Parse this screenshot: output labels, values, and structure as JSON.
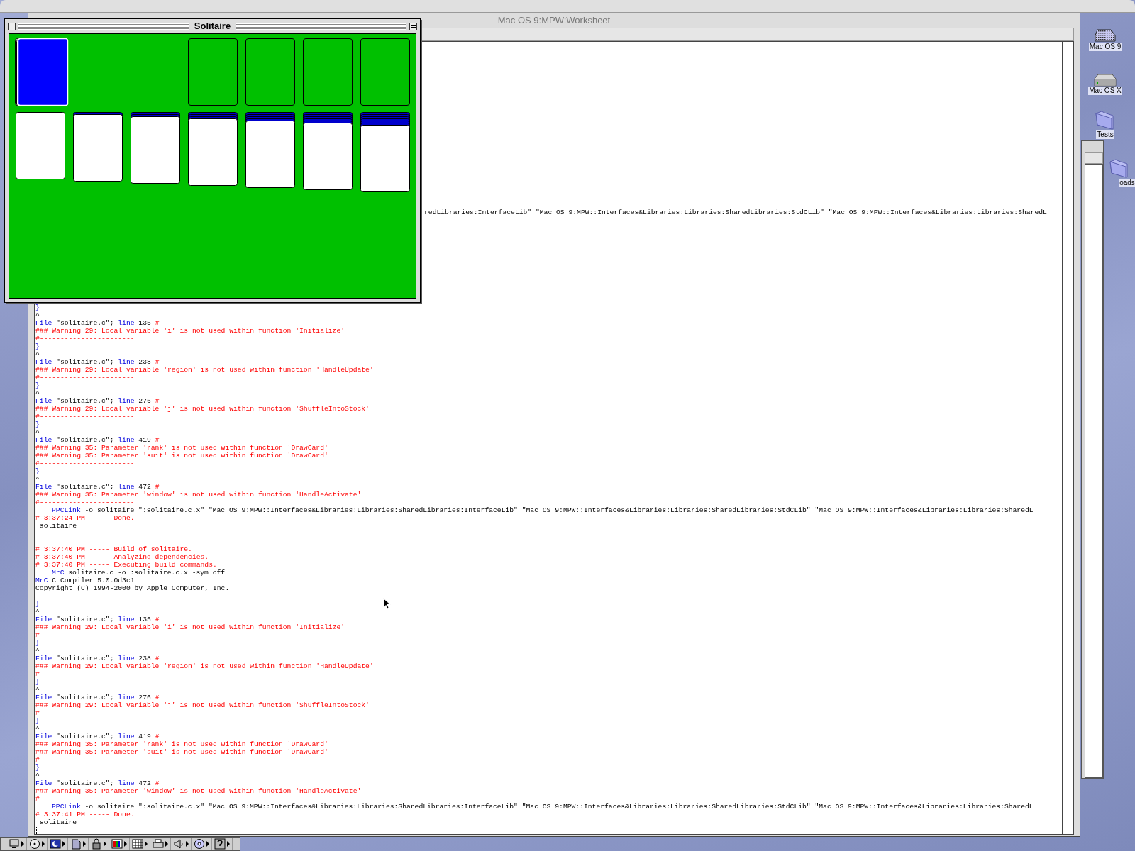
{
  "worksheet": {
    "title": "Mac OS 9:MPW:Worksheet",
    "lines": [
      {
        "kind": "fragment",
        "segments": [
          {
            "kind": "plain",
            "text": "redLibraries:InterfaceLib\" \"Mac OS 9:MPW::Interfaces&Libraries:Libraries:SharedLibraries:StdCLib\" \"Mac OS 9:MPW::Interfaces&Libraries:Libraries:SharedL"
          }
        ]
      },
      {
        "kind": "text",
        "segments": [
          {
            "kind": "keyword",
            "text": "}"
          }
        ]
      },
      {
        "kind": "text",
        "segments": [
          {
            "kind": "plain",
            "text": "^"
          }
        ]
      },
      {
        "kind": "text",
        "segments": [
          {
            "kind": "keyword",
            "text": "File"
          },
          {
            "kind": "plain",
            "text": " \"solitaire.c\"; "
          },
          {
            "kind": "keyword",
            "text": "line"
          },
          {
            "kind": "plain",
            "text": " 135 "
          },
          {
            "kind": "error",
            "text": "#"
          }
        ]
      },
      {
        "kind": "text",
        "segments": [
          {
            "kind": "error",
            "text": "### Warning 29: Local variable 'i' is not used within function 'Initialize'"
          }
        ]
      },
      {
        "kind": "text",
        "segments": [
          {
            "kind": "error",
            "text": "#-----------------------"
          }
        ]
      },
      {
        "kind": "text",
        "segments": [
          {
            "kind": "keyword",
            "text": "}"
          }
        ]
      },
      {
        "kind": "text",
        "segments": [
          {
            "kind": "plain",
            "text": "^"
          }
        ]
      },
      {
        "kind": "text",
        "segments": [
          {
            "kind": "keyword",
            "text": "File"
          },
          {
            "kind": "plain",
            "text": " \"solitaire.c\"; "
          },
          {
            "kind": "keyword",
            "text": "line"
          },
          {
            "kind": "plain",
            "text": " 238 "
          },
          {
            "kind": "error",
            "text": "#"
          }
        ]
      },
      {
        "kind": "text",
        "segments": [
          {
            "kind": "error",
            "text": "### Warning 29: Local variable 'region' is not used within function 'HandleUpdate'"
          }
        ]
      },
      {
        "kind": "text",
        "segments": [
          {
            "kind": "error",
            "text": "#-----------------------"
          }
        ]
      },
      {
        "kind": "text",
        "segments": [
          {
            "kind": "keyword",
            "text": "}"
          }
        ]
      },
      {
        "kind": "text",
        "segments": [
          {
            "kind": "plain",
            "text": "^"
          }
        ]
      },
      {
        "kind": "text",
        "segments": [
          {
            "kind": "keyword",
            "text": "File"
          },
          {
            "kind": "plain",
            "text": " \"solitaire.c\"; "
          },
          {
            "kind": "keyword",
            "text": "line"
          },
          {
            "kind": "plain",
            "text": " 276 "
          },
          {
            "kind": "error",
            "text": "#"
          }
        ]
      },
      {
        "kind": "text",
        "segments": [
          {
            "kind": "error",
            "text": "### Warning 29: Local variable 'j' is not used within function 'ShuffleIntoStock'"
          }
        ]
      },
      {
        "kind": "text",
        "segments": [
          {
            "kind": "error",
            "text": "#-----------------------"
          }
        ]
      },
      {
        "kind": "text",
        "segments": [
          {
            "kind": "keyword",
            "text": "}"
          }
        ]
      },
      {
        "kind": "text",
        "segments": [
          {
            "kind": "plain",
            "text": "^"
          }
        ]
      },
      {
        "kind": "text",
        "segments": [
          {
            "kind": "keyword",
            "text": "File"
          },
          {
            "kind": "plain",
            "text": " \"solitaire.c\"; "
          },
          {
            "kind": "keyword",
            "text": "line"
          },
          {
            "kind": "plain",
            "text": " 419 "
          },
          {
            "kind": "error",
            "text": "#"
          }
        ]
      },
      {
        "kind": "text",
        "segments": [
          {
            "kind": "error",
            "text": "### Warning 35: Parameter 'rank' is not used within function 'DrawCard'"
          }
        ]
      },
      {
        "kind": "text",
        "segments": [
          {
            "kind": "error",
            "text": "### Warning 35: Parameter 'suit' is not used within function 'DrawCard'"
          }
        ]
      },
      {
        "kind": "text",
        "segments": [
          {
            "kind": "error",
            "text": "#-----------------------"
          }
        ]
      },
      {
        "kind": "text",
        "segments": [
          {
            "kind": "keyword",
            "text": "}"
          }
        ]
      },
      {
        "kind": "text",
        "segments": [
          {
            "kind": "plain",
            "text": "^"
          }
        ]
      },
      {
        "kind": "text",
        "segments": [
          {
            "kind": "keyword",
            "text": "File"
          },
          {
            "kind": "plain",
            "text": " \"solitaire.c\"; "
          },
          {
            "kind": "keyword",
            "text": "line"
          },
          {
            "kind": "plain",
            "text": " 472 "
          },
          {
            "kind": "error",
            "text": "#"
          }
        ]
      },
      {
        "kind": "text",
        "segments": [
          {
            "kind": "error",
            "text": "### Warning 35: Parameter 'window' is not used within function 'HandleActivate'"
          }
        ]
      },
      {
        "kind": "text",
        "segments": [
          {
            "kind": "error",
            "text": "#-----------------------"
          }
        ]
      },
      {
        "kind": "indented",
        "segments": [
          {
            "kind": "keyword",
            "text": "PPCLink"
          },
          {
            "kind": "plain",
            "text": " -o solitaire \":solitaire.c.x\" \"Mac OS 9:MPW::Interfaces&Libraries:Libraries:SharedLibraries:InterfaceLib\" \"Mac OS 9:MPW::Interfaces&Libraries:Libraries:SharedLibraries:StdCLib\" \"Mac OS 9:MPW::Interfaces&Libraries:Libraries:SharedL"
          }
        ]
      },
      {
        "kind": "text",
        "segments": [
          {
            "kind": "error",
            "text": "# 3:37:24 PM ----- Done."
          }
        ]
      },
      {
        "kind": "text",
        "segments": [
          {
            "kind": "plain",
            "text": " solitaire"
          }
        ]
      },
      {
        "kind": "blank"
      },
      {
        "kind": "blank"
      },
      {
        "kind": "text",
        "segments": [
          {
            "kind": "error",
            "text": "# 3:37:40 PM ----- Build of solitaire."
          }
        ]
      },
      {
        "kind": "text",
        "segments": [
          {
            "kind": "error",
            "text": "# 3:37:40 PM ----- Analyzing dependencies."
          }
        ]
      },
      {
        "kind": "text",
        "segments": [
          {
            "kind": "error",
            "text": "# 3:37:40 PM ----- Executing build commands."
          }
        ]
      },
      {
        "kind": "indented",
        "segments": [
          {
            "kind": "keyword",
            "text": "MrC"
          },
          {
            "kind": "plain",
            "text": " solitaire.c -o :solitaire.c.x -sym off"
          }
        ]
      },
      {
        "kind": "text",
        "segments": [
          {
            "kind": "keyword",
            "text": "MrC"
          },
          {
            "kind": "plain",
            "text": " C Compiler 5.0.0d3c1"
          }
        ]
      },
      {
        "kind": "text",
        "segments": [
          {
            "kind": "plain",
            "text": "Copyright (C) 1994-2000 by Apple Computer, Inc."
          }
        ]
      },
      {
        "kind": "blank"
      },
      {
        "kind": "text",
        "segments": [
          {
            "kind": "keyword",
            "text": "}"
          }
        ]
      },
      {
        "kind": "text",
        "segments": [
          {
            "kind": "plain",
            "text": "^"
          }
        ]
      },
      {
        "kind": "text",
        "segments": [
          {
            "kind": "keyword",
            "text": "File"
          },
          {
            "kind": "plain",
            "text": " \"solitaire.c\"; "
          },
          {
            "kind": "keyword",
            "text": "line"
          },
          {
            "kind": "plain",
            "text": " 135 "
          },
          {
            "kind": "error",
            "text": "#"
          }
        ]
      },
      {
        "kind": "text",
        "segments": [
          {
            "kind": "error",
            "text": "### Warning 29: Local variable 'i' is not used within function 'Initialize'"
          }
        ]
      },
      {
        "kind": "text",
        "segments": [
          {
            "kind": "error",
            "text": "#-----------------------"
          }
        ]
      },
      {
        "kind": "text",
        "segments": [
          {
            "kind": "keyword",
            "text": "}"
          }
        ]
      },
      {
        "kind": "text",
        "segments": [
          {
            "kind": "plain",
            "text": "^"
          }
        ]
      },
      {
        "kind": "text",
        "segments": [
          {
            "kind": "keyword",
            "text": "File"
          },
          {
            "kind": "plain",
            "text": " \"solitaire.c\"; "
          },
          {
            "kind": "keyword",
            "text": "line"
          },
          {
            "kind": "plain",
            "text": " 238 "
          },
          {
            "kind": "error",
            "text": "#"
          }
        ]
      },
      {
        "kind": "text",
        "segments": [
          {
            "kind": "error",
            "text": "### Warning 29: Local variable 'region' is not used within function 'HandleUpdate'"
          }
        ]
      },
      {
        "kind": "text",
        "segments": [
          {
            "kind": "error",
            "text": "#-----------------------"
          }
        ]
      },
      {
        "kind": "text",
        "segments": [
          {
            "kind": "keyword",
            "text": "}"
          }
        ]
      },
      {
        "kind": "text",
        "segments": [
          {
            "kind": "plain",
            "text": "^"
          }
        ]
      },
      {
        "kind": "text",
        "segments": [
          {
            "kind": "keyword",
            "text": "File"
          },
          {
            "kind": "plain",
            "text": " \"solitaire.c\"; "
          },
          {
            "kind": "keyword",
            "text": "line"
          },
          {
            "kind": "plain",
            "text": " 276 "
          },
          {
            "kind": "error",
            "text": "#"
          }
        ]
      },
      {
        "kind": "text",
        "segments": [
          {
            "kind": "error",
            "text": "### Warning 29: Local variable 'j' is not used within function 'ShuffleIntoStock'"
          }
        ]
      },
      {
        "kind": "text",
        "segments": [
          {
            "kind": "error",
            "text": "#-----------------------"
          }
        ]
      },
      {
        "kind": "text",
        "segments": [
          {
            "kind": "keyword",
            "text": "}"
          }
        ]
      },
      {
        "kind": "text",
        "segments": [
          {
            "kind": "plain",
            "text": "^"
          }
        ]
      },
      {
        "kind": "text",
        "segments": [
          {
            "kind": "keyword",
            "text": "File"
          },
          {
            "kind": "plain",
            "text": " \"solitaire.c\"; "
          },
          {
            "kind": "keyword",
            "text": "line"
          },
          {
            "kind": "plain",
            "text": " 419 "
          },
          {
            "kind": "error",
            "text": "#"
          }
        ]
      },
      {
        "kind": "text",
        "segments": [
          {
            "kind": "error",
            "text": "### Warning 35: Parameter 'rank' is not used within function 'DrawCard'"
          }
        ]
      },
      {
        "kind": "text",
        "segments": [
          {
            "kind": "error",
            "text": "### Warning 35: Parameter 'suit' is not used within function 'DrawCard'"
          }
        ]
      },
      {
        "kind": "text",
        "segments": [
          {
            "kind": "error",
            "text": "#-----------------------"
          }
        ]
      },
      {
        "kind": "text",
        "segments": [
          {
            "kind": "keyword",
            "text": "}"
          }
        ]
      },
      {
        "kind": "text",
        "segments": [
          {
            "kind": "plain",
            "text": "^"
          }
        ]
      },
      {
        "kind": "text",
        "segments": [
          {
            "kind": "keyword",
            "text": "File"
          },
          {
            "kind": "plain",
            "text": " \"solitaire.c\"; "
          },
          {
            "kind": "keyword",
            "text": "line"
          },
          {
            "kind": "plain",
            "text": " 472 "
          },
          {
            "kind": "error",
            "text": "#"
          }
        ]
      },
      {
        "kind": "text",
        "segments": [
          {
            "kind": "error",
            "text": "### Warning 35: Parameter 'window' is not used within function 'HandleActivate'"
          }
        ]
      },
      {
        "kind": "text",
        "segments": [
          {
            "kind": "error",
            "text": "#-----------------------"
          }
        ]
      },
      {
        "kind": "indented",
        "segments": [
          {
            "kind": "keyword",
            "text": "PPCLink"
          },
          {
            "kind": "plain",
            "text": " -o solitaire \":solitaire.c.x\" \"Mac OS 9:MPW::Interfaces&Libraries:Libraries:SharedLibraries:InterfaceLib\" \"Mac OS 9:MPW::Interfaces&Libraries:Libraries:SharedLibraries:StdCLib\" \"Mac OS 9:MPW::Interfaces&Libraries:Libraries:SharedL"
          }
        ]
      },
      {
        "kind": "text",
        "segments": [
          {
            "kind": "error",
            "text": "# 3:37:41 PM ----- Done."
          }
        ]
      },
      {
        "kind": "text",
        "segments": [
          {
            "kind": "plain",
            "text": " solitaire"
          }
        ]
      },
      {
        "kind": "cursor"
      }
    ]
  },
  "solitaire": {
    "title": "Solitaire"
  },
  "desktop_icons": [
    {
      "label": "Mac OS 9",
      "kind": "disk"
    },
    {
      "label": "Mac OS X",
      "kind": "drive"
    },
    {
      "label": "Tests",
      "kind": "folder"
    },
    {
      "label": "oads",
      "kind": "folder"
    }
  ]
}
